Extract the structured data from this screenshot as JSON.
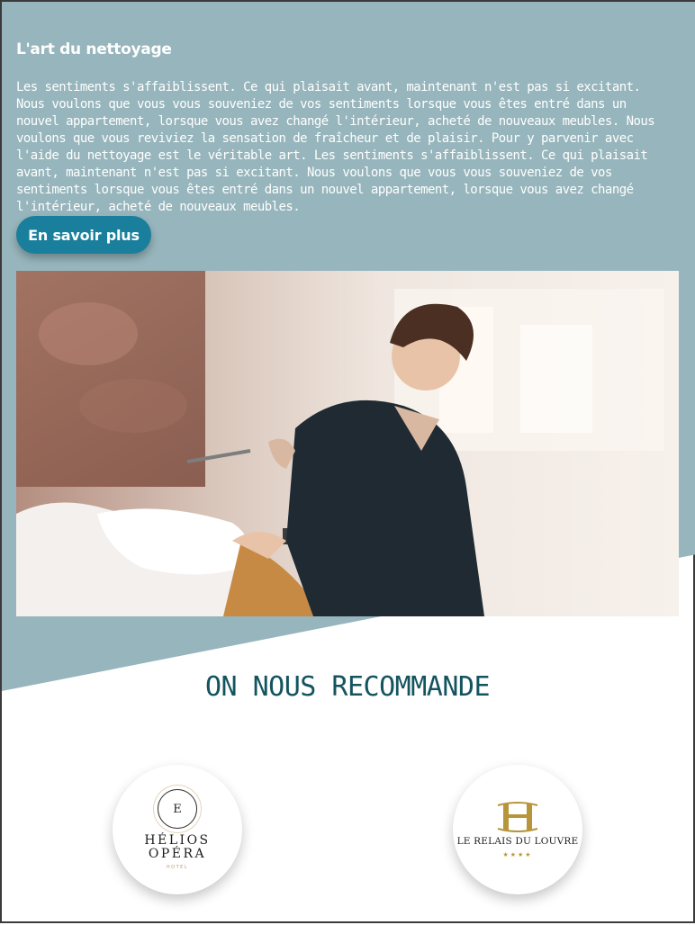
{
  "colors": {
    "teal_background": "#97b5bc",
    "button_blue": "#1a7f9c",
    "heading_teal": "#14545f",
    "gold": "#b8953a"
  },
  "intro": {
    "title": "L'art du nettoyage",
    "body": "Les sentiments s'affaiblissent. Ce qui plaisait avant, maintenant n'est pas si excitant. Nous voulons que vous vous souveniez de vos sentiments lorsque vous êtes entré dans un nouvel appartement, lorsque vous avez changé l'intérieur, acheté de nouveaux meubles. Nous voulons que vous reviviez la sensation de fraîcheur et de plaisir. Pour y parvenir avec l'aide du nettoyage est le véritable art. Les sentiments s'affaiblissent. Ce qui plaisait avant, maintenant n'est pas si excitant. Nous voulons que vous vous souveniez de vos sentiments lorsque vous êtes entré dans un nouvel appartement, lorsque vous avez changé l'intérieur, acheté de nouveaux meubles.",
    "button_label": "En savoir plus"
  },
  "recommend": {
    "title": "ON NOUS RECOMMANDE",
    "partners": [
      {
        "emblem_letter": "E",
        "name_line1": "HÉLIOS",
        "name_line2": "OPÉRA",
        "subtitle": "HOTEL"
      },
      {
        "name": "LE RELAIS DU LOUVRE",
        "stars": "★★★★"
      }
    ]
  }
}
